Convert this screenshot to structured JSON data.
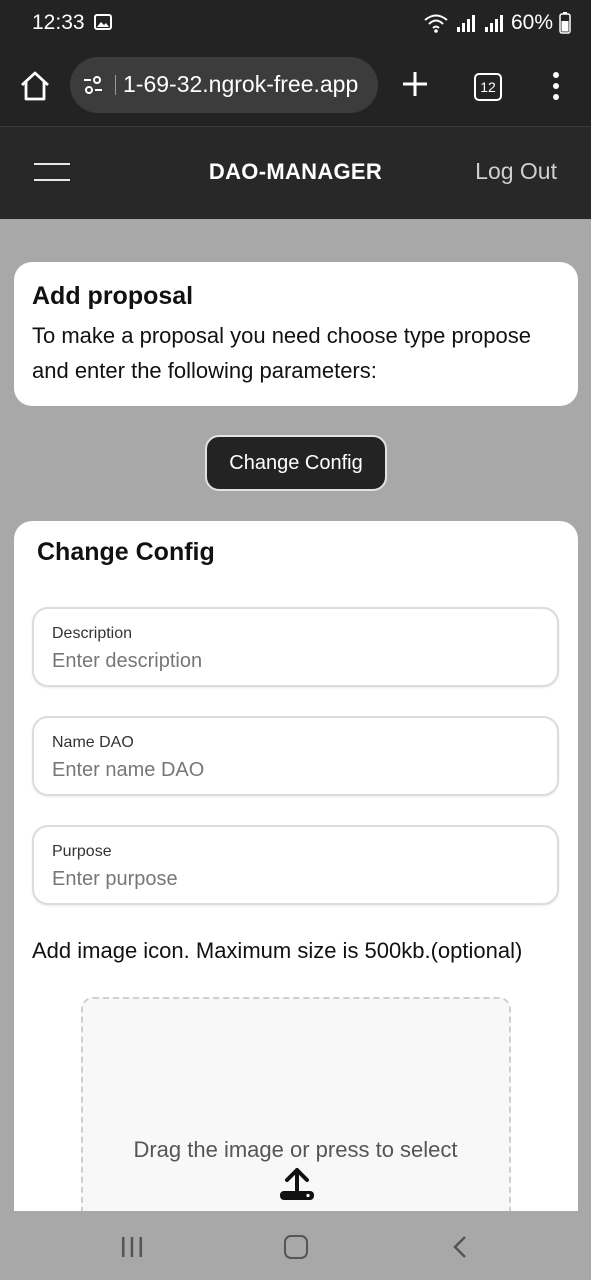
{
  "status_bar": {
    "time": "12:33",
    "battery": "60%"
  },
  "browser": {
    "url": "1-69-32.ngrok-free.app",
    "tab_count": "12"
  },
  "header": {
    "title": "DAO-MANAGER",
    "logout_label": "Log Out"
  },
  "intro": {
    "title": "Add proposal",
    "text": "To make a proposal you need choose type propose and enter the following parameters:"
  },
  "proposal_type_button": "Change Config",
  "form": {
    "title": "Change Config",
    "fields": [
      {
        "label": "Description",
        "placeholder": "Enter description",
        "value": ""
      },
      {
        "label": "Name DAO",
        "placeholder": "Enter name DAO",
        "value": ""
      },
      {
        "label": "Purpose",
        "placeholder": "Enter purpose",
        "value": ""
      }
    ],
    "image_note": "Add image icon. Maximum size is 500kb.(optional)",
    "dropzone_text": "Drag the image or press to select"
  },
  "icons": {
    "home": "home-icon",
    "tune": "site-settings-icon",
    "plus": "plus-icon",
    "tabs": "tabs-icon",
    "more": "more-vert-icon",
    "menu": "hamburger-icon",
    "upload": "upload-icon",
    "wifi": "wifi-icon",
    "signal": "signal-icon",
    "battery": "battery-icon",
    "image": "image-icon"
  },
  "colors": {
    "top_bar": "#232323",
    "app_header": "#282828",
    "page_background": "#a8a8a8",
    "card": "#ffffff"
  }
}
